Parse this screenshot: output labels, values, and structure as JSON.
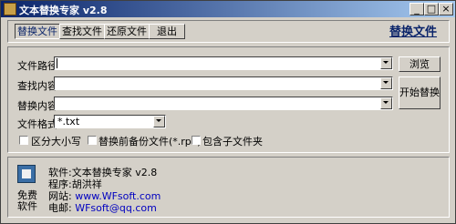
{
  "window": {
    "title": "文本替换专家 v2.8",
    "min_glyph": "_",
    "max_glyph": "□",
    "close_glyph": "×"
  },
  "toolbar": {
    "replace_files": "替换文件",
    "find_files": "查找文件",
    "restore_files": "还原文件",
    "exit": "退出",
    "brand_title": "替换文件"
  },
  "form": {
    "file_path_label": "文件路径:",
    "file_path_value": "",
    "find_label": "查找内容:",
    "find_value": "",
    "replace_label": "替换内容:",
    "replace_value": "",
    "format_label": "文件格式:",
    "format_value": "*.txt",
    "browse_button": "浏览",
    "start_button": "开始替换"
  },
  "options": {
    "case_sensitive": {
      "label": "区分大小写",
      "checked": false
    },
    "backup_before_replace": {
      "label": "替换前备份文件(*.rpk)",
      "checked": false
    },
    "include_subfolders": {
      "label": "包含子文件夹",
      "checked": false
    }
  },
  "info": {
    "free_line1": "免费",
    "free_line2": "软件",
    "software_label": "软件:",
    "software_value": "文本替换专家 v2.8",
    "program_label": "程序:",
    "program_value": "胡洪祥",
    "website_label": "网站:",
    "website_value": "www.WFsoft.com",
    "email_label": "电邮:",
    "email_value": "WFsoft@qq.com"
  }
}
